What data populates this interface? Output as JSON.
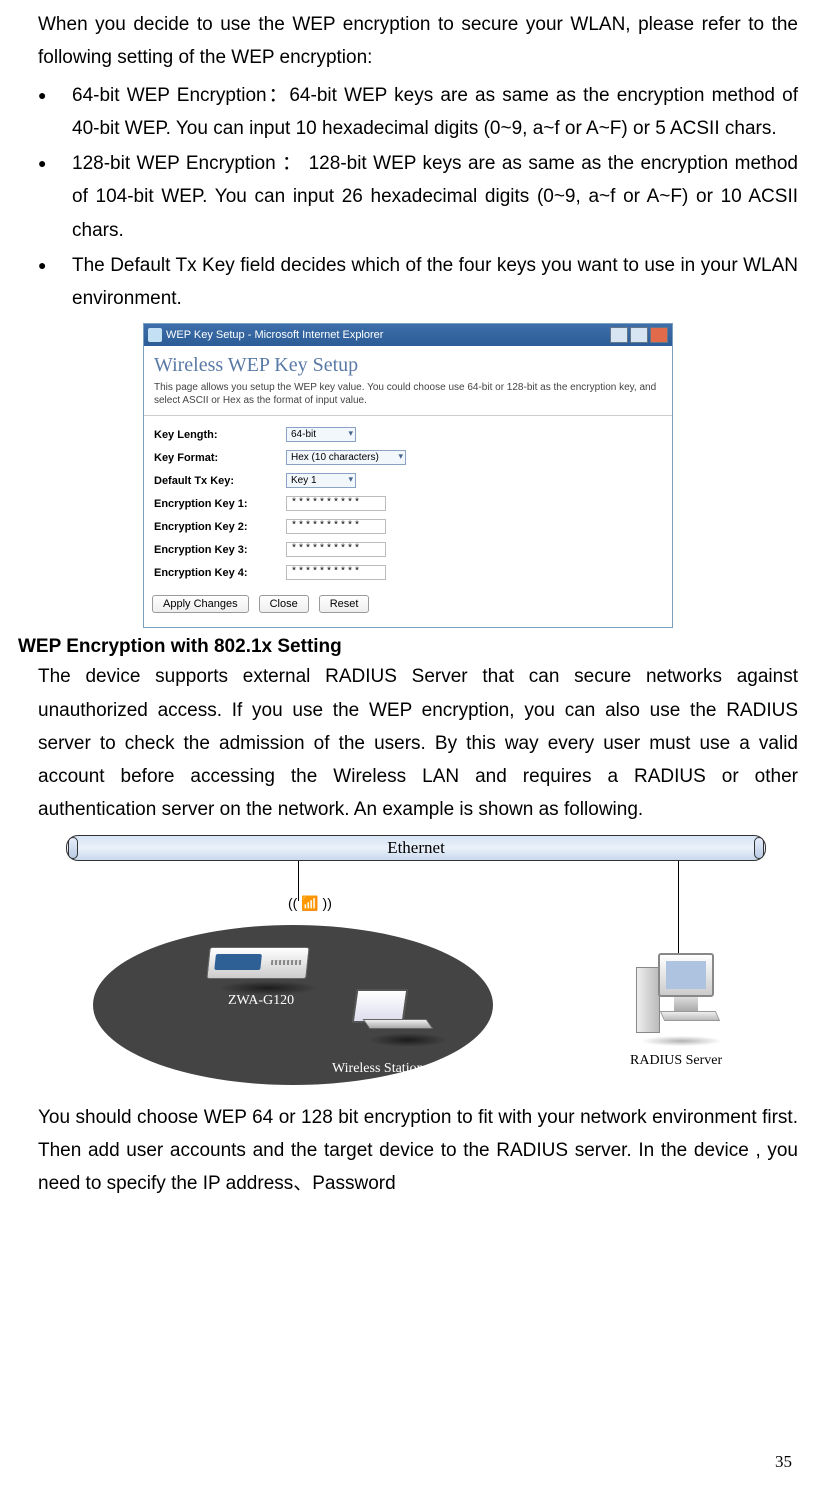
{
  "intro": "When you decide to use the WEP encryption to secure your WLAN, please refer to the following setting of the WEP encryption:",
  "bullets": [
    "64-bit WEP Encryption：64-bit WEP keys are as same as the encryption method of 40-bit WEP. You can input 10 hexadecimal digits (0~9, a~f or A~F) or 5 ACSII chars.",
    "128-bit WEP Encryption ： 128-bit WEP keys are as same as the encryption method of 104-bit WEP. You can input 26 hexadecimal digits (0~9, a~f or A~F) or 10 ACSII chars.",
    "The Default Tx Key field decides which of the four keys you want to use in your WLAN environment."
  ],
  "window": {
    "title": "WEP Key Setup - Microsoft Internet Explorer",
    "page_title": "Wireless WEP Key Setup",
    "desc": "This page allows you setup the WEP key value. You could choose use 64-bit or 128-bit as the encryption key, and select ASCII or Hex as the format of input value.",
    "rows": {
      "key_length_label": "Key Length:",
      "key_length_value": "64-bit",
      "key_format_label": "Key Format:",
      "key_format_value": "Hex (10 characters)",
      "default_tx_label": "Default Tx Key:",
      "default_tx_value": "Key 1",
      "ek1_label": "Encryption Key 1:",
      "ek2_label": "Encryption Key 2:",
      "ek3_label": "Encryption Key 3:",
      "ek4_label": "Encryption Key 4:",
      "masked": "**********"
    },
    "buttons": {
      "apply": "Apply Changes",
      "close": "Close",
      "reset": "Reset"
    }
  },
  "section": {
    "heading": "WEP Encryption with 802.1x Setting",
    "text": "The device supports external RADIUS Server that can secure networks against unauthorized access. If you use the WEP encryption, you can also use the RADIUS server to check the admission of the users. By this way every user must use a valid account before accessing the Wireless LAN and requires a RADIUS or other authentication server on the network. An example is shown as following."
  },
  "diagram": {
    "ethernet": "Ethernet",
    "antenna": "((📡))",
    "zwa": "ZWA-G120",
    "ws": "Wireless Station",
    "radius": "RADIUS Server"
  },
  "post_diagram": "You should choose WEP 64 or 128 bit encryption to fit with your network environment first. Then add user accounts and the target device to the RADIUS server. In the device , you need to specify the IP address、Password",
  "page_number": "35"
}
